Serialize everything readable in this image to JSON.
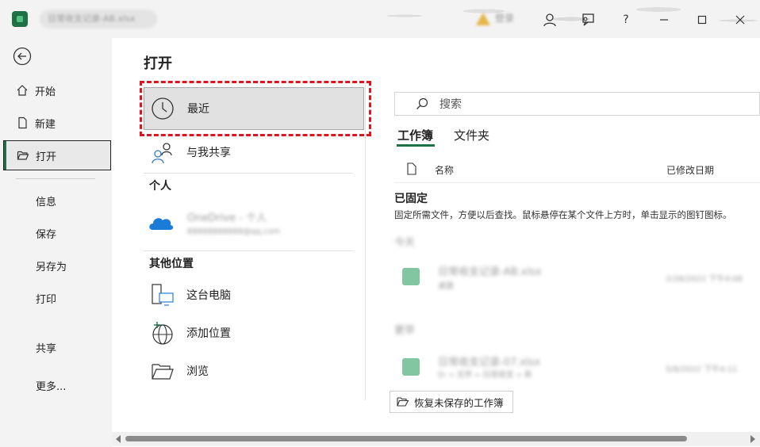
{
  "titlebar": {
    "doc_title": "日常收支记录-AB.xlsx",
    "warning_text": "登录",
    "help_label": "?"
  },
  "nav": {
    "items": [
      {
        "label": "开始"
      },
      {
        "label": "新建"
      },
      {
        "label": "打开"
      },
      {
        "label": "信息"
      },
      {
        "label": "保存"
      },
      {
        "label": "另存为"
      },
      {
        "label": "打印"
      },
      {
        "label": "共享"
      },
      {
        "label": "更多..."
      }
    ]
  },
  "main": {
    "title": "打开",
    "locations": {
      "recent": "最近",
      "shared": "与我共享",
      "personal_header": "个人",
      "onedrive_name": "OneDrive - 个人",
      "onedrive_email": "88888888888@qq.com",
      "other_header": "其他位置",
      "this_pc": "这台电脑",
      "add_place": "添加位置",
      "browse": "浏览"
    },
    "right": {
      "search_placeholder": "搜索",
      "tabs": [
        "工作簿",
        "文件夹"
      ],
      "col_name": "名称",
      "col_modified": "已修改日期",
      "pinned_title": "已固定",
      "pinned_desc": "固定所需文件，方便以后查找。鼠标悬停在某个文件上方时，单击显示的图钉图标。",
      "group_today": "今天",
      "group_earlier": "更早",
      "files": [
        {
          "name": "日常收支记录-AB.xlsx",
          "path": "桌面",
          "date": "2/28/2022 下午4:08"
        },
        {
          "name": "日常收支记录-07.xlsx",
          "path": "D: » 文件 » 日常收支 » 表",
          "date": "5/8/2022 下午4:11"
        }
      ],
      "restore_button": "恢复未保存的工作簿"
    }
  },
  "colors": {
    "accent": "#1e7145",
    "highlight": "#e0141e"
  }
}
